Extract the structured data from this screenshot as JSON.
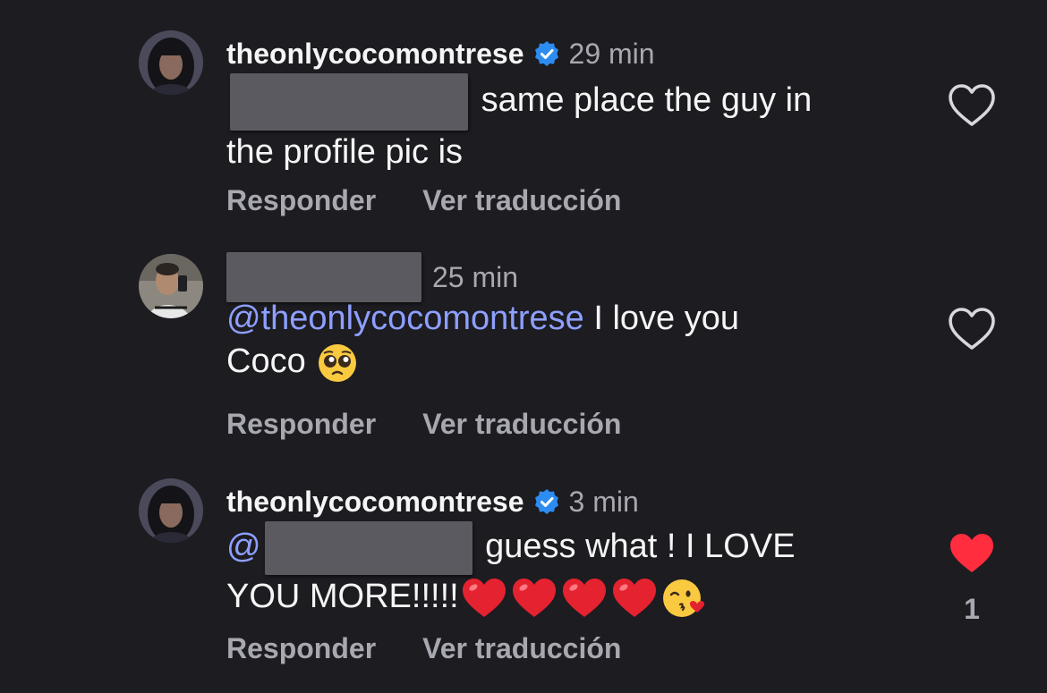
{
  "comments": [
    {
      "username": "theonlycocomontrese",
      "verified": true,
      "time": "29 min",
      "mention_prefix": "",
      "text_line1": "same place the guy in",
      "text_line2": "the profile pic is",
      "liked": false,
      "like_count": ""
    },
    {
      "username": "",
      "verified": false,
      "time": "25 min",
      "mention": "@theonlycocomontrese",
      "text_line1": " I love you",
      "text_line2": "Coco",
      "liked": false,
      "like_count": ""
    },
    {
      "username": "theonlycocomontrese",
      "verified": true,
      "time": "3 min",
      "mention_prefix": "@",
      "text_line1": "guess what ! I LOVE",
      "text_line2": "YOU MORE!!!!!",
      "liked": true,
      "like_count": "1"
    }
  ],
  "actions": {
    "reply_label": "Responder",
    "translate_label": "Ver traducción"
  },
  "icons": {
    "verified": "verified-badge-icon",
    "like": "heart-outline-icon",
    "liked": "heart-filled-icon",
    "emoji_pleading": "pleading-face-emoji",
    "emoji_heart": "red-heart-emoji",
    "emoji_kiss": "face-blowing-kiss-emoji"
  },
  "colors": {
    "background": "#1c1c21",
    "mention": "#8e9fff",
    "verified": "#2d8cf0",
    "liked": "#ff2d3d",
    "muted": "#a8a8b0"
  }
}
